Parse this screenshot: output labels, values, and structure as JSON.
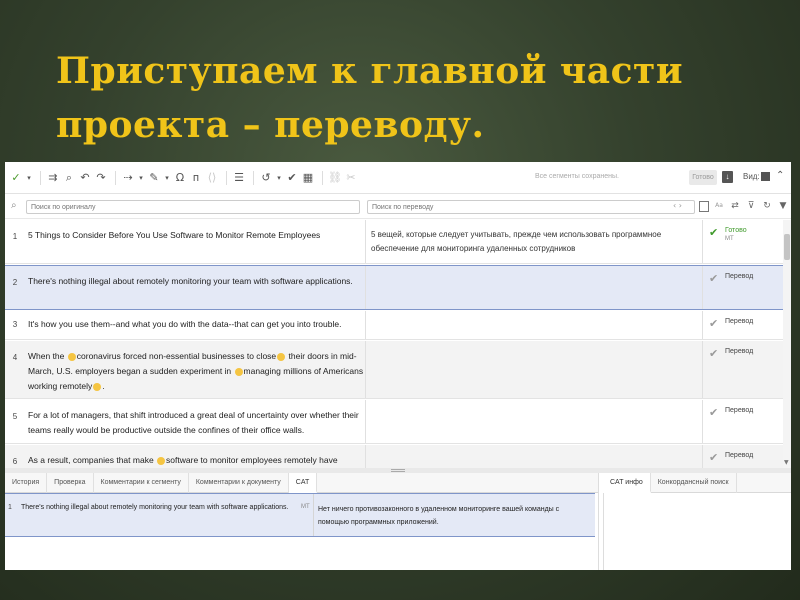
{
  "slide": {
    "title_line1": "Приступаем к главной части",
    "title_line2": "проекта – переводу."
  },
  "toolbar": {
    "status_text": "Все сегменты сохранены.",
    "ready_label": "Готово",
    "view_label": "Вид:"
  },
  "filter": {
    "source_placeholder": "Поиск по оригиналу",
    "target_placeholder": "Поиск по переводу",
    "case_label": "Aa"
  },
  "segments": [
    {
      "num": "1",
      "source": "5 Things to Consider Before You Use Software to Monitor Remote Employees",
      "target": "5 вещей, которые следует учитывать, прежде чем использовать программное обеспечение для мониторинга удаленных сотрудников",
      "status": "Готово",
      "status_sub": "МТ"
    },
    {
      "num": "2",
      "source": "There's nothing illegal about remotely monitoring your team with software applications.",
      "target": "",
      "status": "Перевод",
      "status_sub": ""
    },
    {
      "num": "3",
      "source": "It's how you use them--and what you do with the data--that can get you into trouble.",
      "target": "",
      "status": "Перевод",
      "status_sub": ""
    },
    {
      "num": "4",
      "source_parts": [
        "When the",
        "coronavirus forced non-essential businesses to close",
        "their doors in mid-March, U.S. employers began a sudden experiment in",
        "managing millions of Americans working remotely",
        "."
      ],
      "target": "",
      "status": "Перевод",
      "status_sub": ""
    },
    {
      "num": "5",
      "source": "For a lot of managers, that shift introduced a great deal of uncertainty over whether their teams really would be productive outside the confines of their office walls.",
      "target": "",
      "status": "Перевод",
      "status_sub": ""
    },
    {
      "num": "6",
      "source_parts": [
        "As a result, companies that make",
        "software to monitor employees remotely have"
      ],
      "target": "",
      "status": "Перевод",
      "status_sub": ""
    }
  ],
  "bottom_tabs": [
    "История",
    "Проверка",
    "Комментарии к сегменту",
    "Комментарии к документу",
    "CAT"
  ],
  "cat": {
    "num": "1",
    "source": "There's nothing illegal about remotely monitoring your team with software applications.",
    "mt_label": "МТ",
    "target": "Нет ничего противозаконного в удаленном мониторинге вашей команды с помощью программных приложений."
  },
  "right_tabs": [
    "CAT инфо",
    "Конкордансный поиск"
  ]
}
